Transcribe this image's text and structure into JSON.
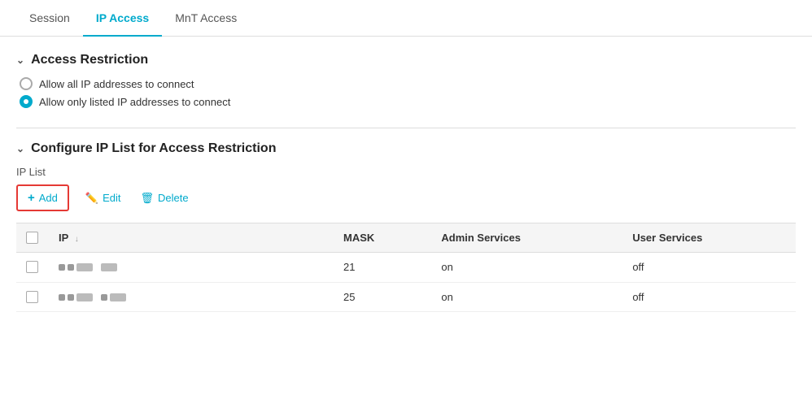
{
  "tabs": [
    {
      "id": "session",
      "label": "Session",
      "active": false
    },
    {
      "id": "ip-access",
      "label": "IP Access",
      "active": true
    },
    {
      "id": "mnt-access",
      "label": "MnT Access",
      "active": false
    }
  ],
  "access_restriction": {
    "section_title": "Access Restriction",
    "options": [
      {
        "id": "allow-all",
        "label": "Allow all IP addresses to connect",
        "selected": false
      },
      {
        "id": "allow-listed",
        "label": "Allow only listed IP addresses to connect",
        "selected": true
      }
    ]
  },
  "ip_list_section": {
    "section_title": "Configure IP List for Access Restriction",
    "list_label": "IP List",
    "toolbar": {
      "add_label": "Add",
      "edit_label": "Edit",
      "delete_label": "Delete"
    },
    "table": {
      "columns": [
        {
          "id": "checkbox",
          "label": ""
        },
        {
          "id": "ip",
          "label": "IP",
          "sortable": true
        },
        {
          "id": "mask",
          "label": "MASK"
        },
        {
          "id": "admin-services",
          "label": "Admin Services"
        },
        {
          "id": "user-services",
          "label": "User Services"
        }
      ],
      "rows": [
        {
          "id": 1,
          "ip_display": "blurred-1",
          "mask": "21",
          "admin_services": "on",
          "user_services": "off"
        },
        {
          "id": 2,
          "ip_display": "blurred-2",
          "mask": "25",
          "admin_services": "on",
          "user_services": "off"
        }
      ]
    }
  }
}
